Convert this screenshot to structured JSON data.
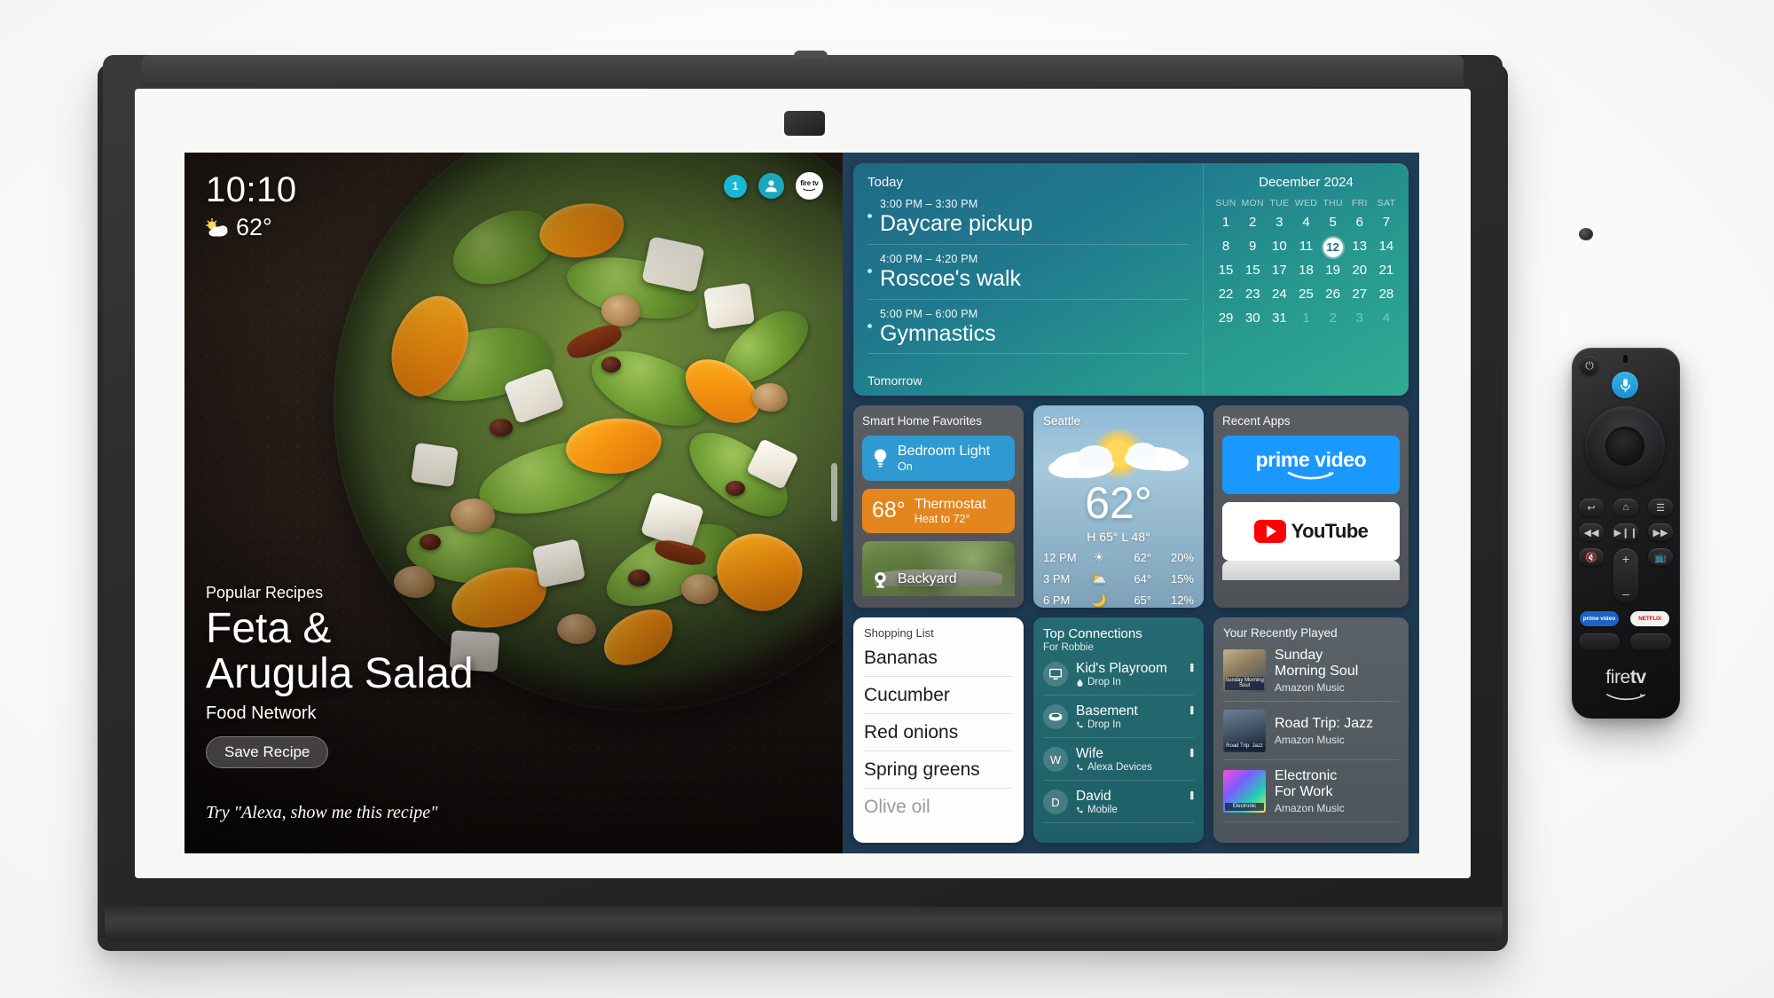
{
  "device": {
    "name": "Echo Show smart display",
    "brand_logo": "fire tv"
  },
  "hero": {
    "clock": "10:10",
    "temperature": "62°",
    "weather_icon": "partly-cloudy-icon",
    "notification_count": "1",
    "avatar_icon": "person-icon",
    "brand_chip": "fire tv",
    "kicker": "Popular Recipes",
    "title": "Feta &\nArugula Salad",
    "title_line1": "Feta &",
    "title_line2": "Arugula Salad",
    "source": "Food Network",
    "save_label": "Save Recipe",
    "hint": "Try \"Alexa, show me this recipe\""
  },
  "calendar_widget": {
    "today_label": "Today",
    "tomorrow_label": "Tomorrow",
    "events": [
      {
        "time": "3:00 PM – 3:30 PM",
        "title": "Daycare pickup"
      },
      {
        "time": "4:00 PM – 4:20 PM",
        "title": "Roscoe's walk"
      },
      {
        "time": "5:00 PM – 6:00 PM",
        "title": "Gymnastics"
      }
    ],
    "month": "December 2024",
    "dow": [
      "SUN",
      "MON",
      "TUE",
      "WED",
      "THU",
      "FRI",
      "SAT"
    ],
    "days": [
      {
        "d": "1",
        "out": false
      },
      {
        "d": "2",
        "out": false
      },
      {
        "d": "3",
        "out": false
      },
      {
        "d": "4",
        "out": false
      },
      {
        "d": "5",
        "out": false
      },
      {
        "d": "6",
        "out": false
      },
      {
        "d": "7",
        "out": false
      },
      {
        "d": "8",
        "out": false
      },
      {
        "d": "9",
        "out": false
      },
      {
        "d": "10",
        "out": false
      },
      {
        "d": "11",
        "out": false
      },
      {
        "d": "12",
        "out": false,
        "today": true
      },
      {
        "d": "13",
        "out": false
      },
      {
        "d": "14",
        "out": false
      },
      {
        "d": "15",
        "out": false
      },
      {
        "d": "15",
        "out": false
      },
      {
        "d": "17",
        "out": false
      },
      {
        "d": "18",
        "out": false
      },
      {
        "d": "19",
        "out": false
      },
      {
        "d": "20",
        "out": false
      },
      {
        "d": "21",
        "out": false
      },
      {
        "d": "22",
        "out": false
      },
      {
        "d": "23",
        "out": false
      },
      {
        "d": "24",
        "out": false
      },
      {
        "d": "25",
        "out": false
      },
      {
        "d": "26",
        "out": false
      },
      {
        "d": "27",
        "out": false
      },
      {
        "d": "28",
        "out": false
      },
      {
        "d": "29",
        "out": false
      },
      {
        "d": "30",
        "out": false
      },
      {
        "d": "31",
        "out": false
      },
      {
        "d": "1",
        "out": true
      },
      {
        "d": "2",
        "out": true
      },
      {
        "d": "3",
        "out": true
      },
      {
        "d": "4",
        "out": true
      }
    ],
    "today": "12"
  },
  "smart_home": {
    "title": "Smart Home Favorites",
    "tiles": [
      {
        "icon": "lightbulb-icon",
        "name": "Bedroom Light",
        "state": "On",
        "color": "#2f9ad1"
      },
      {
        "icon": "thermostat-icon",
        "value": "68°",
        "name": "Thermostat",
        "state": "Heat to 72°",
        "color": "#e3861d"
      },
      {
        "icon": "camera-icon",
        "name": "Backyard"
      }
    ]
  },
  "weather": {
    "city": "Seattle",
    "icon": "sun-behind-cloud-icon",
    "current_temp": "62°",
    "high_low": "H 65°  L 48°",
    "hourly": [
      {
        "time": "12 PM",
        "icon": "☀",
        "temp": "62°",
        "precip": "20%"
      },
      {
        "time": "3 PM",
        "icon": "⛅",
        "temp": "64°",
        "precip": "15%"
      },
      {
        "time": "6 PM",
        "icon": "🌙",
        "temp": "65°",
        "precip": "12%"
      }
    ]
  },
  "recent_apps": {
    "title": "Recent Apps",
    "apps": [
      {
        "name": "prime video",
        "logo": "prime-video-logo"
      },
      {
        "name": "YouTube",
        "logo": "youtube-logo"
      },
      {
        "name": "",
        "logo": "partial-app-tile"
      }
    ]
  },
  "shopping_list": {
    "title": "Shopping List",
    "items": [
      {
        "text": "Bananas",
        "faded": false
      },
      {
        "text": "Cucumber",
        "faded": false
      },
      {
        "text": "Red onions",
        "faded": false
      },
      {
        "text": "Spring greens",
        "faded": false
      },
      {
        "text": "Olive oil",
        "faded": true
      }
    ]
  },
  "connections": {
    "title": "Top Connections",
    "subtitle": "For Robbie",
    "rows": [
      {
        "avatar": "monitor-icon",
        "initial": "",
        "name": "Kid's Playroom",
        "action_icon": "drop-in-icon",
        "action": "Drop In"
      },
      {
        "avatar": "echo-device-icon",
        "initial": "",
        "name": "Basement",
        "action_icon": "phone-icon",
        "action": "Drop In"
      },
      {
        "avatar": "",
        "initial": "W",
        "name": "Wife",
        "action_icon": "phone-icon",
        "action": "Alexa Devices"
      },
      {
        "avatar": "",
        "initial": "D",
        "name": "David",
        "action_icon": "phone-icon",
        "action": "Mobile"
      }
    ],
    "more_icon": "overflow-menu-icon"
  },
  "recently_played": {
    "title": "Your Recently Played",
    "items": [
      {
        "name_line1": "Sunday",
        "name_line2": "Morning Soul",
        "source": "Amazon Music",
        "art_label": "Sunday Morning Soul"
      },
      {
        "name_line1": "Road Trip: Jazz",
        "name_line2": "",
        "source": "Amazon Music",
        "art_label": "Road Trip: Jazz"
      },
      {
        "name_line1": "Electronic",
        "name_line2": "For Work",
        "source": "Amazon Music",
        "art_label": "Electronic"
      }
    ]
  },
  "remote": {
    "brand": "fire tv",
    "brand_fire": "fire",
    "brand_tv": "tv",
    "buttons": {
      "power": "power-icon",
      "mic": "microphone-icon",
      "back": "back-arrow-icon",
      "home": "home-icon",
      "menu": "menu-icon",
      "rewind": "rewind-icon",
      "playpause": "play-pause-icon",
      "fastforward": "fast-forward-icon",
      "mute": "mute-icon",
      "volume_up": "volume-up-icon",
      "volume_down": "volume-down-icon",
      "guide": "tv-guide-icon",
      "prime_video": "prime video",
      "netflix": "NETFLIX"
    }
  },
  "colors": {
    "accent_teal": "#1aa8bf",
    "calendar_gradient_start": "#1f6a86",
    "calendar_gradient_end": "#30ab94",
    "light_tile": "#2f9ad1",
    "thermostat_tile": "#e3861d",
    "prime_blue": "#1a98ff",
    "youtube_red": "#ff0000",
    "netflix_red": "#e50914"
  }
}
